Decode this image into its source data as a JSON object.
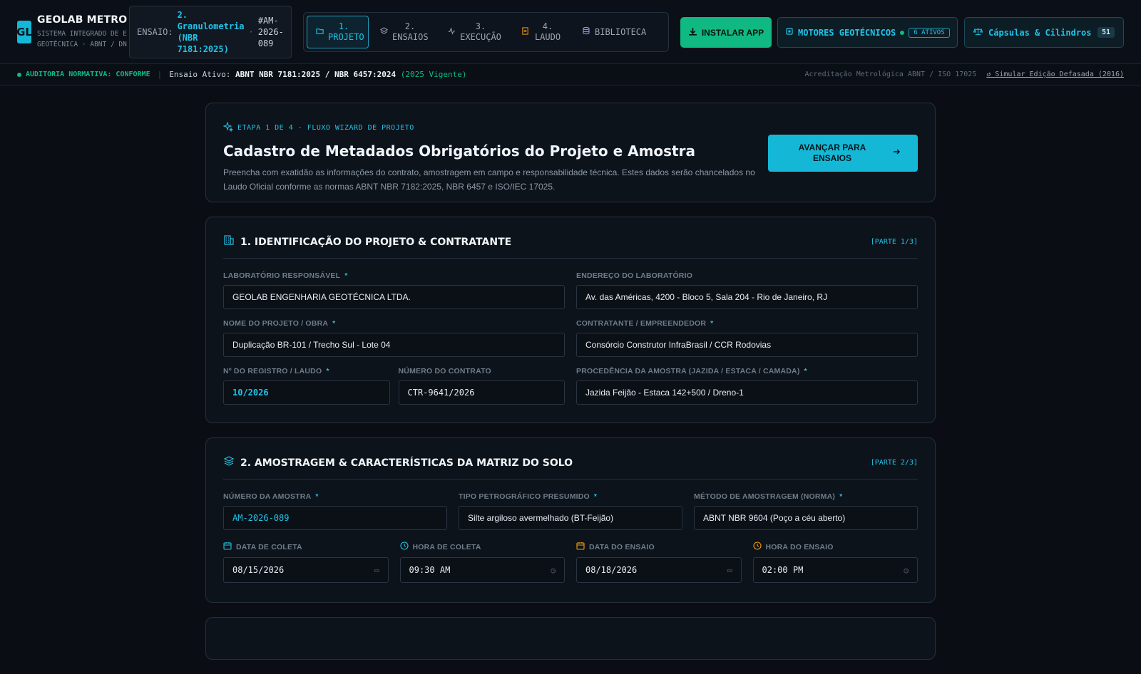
{
  "header": {
    "logo": "GL",
    "title": "GEOLAB METROL…",
    "subtitle_1": "SISTEMA INTEGRADO DE E",
    "subtitle_2": "GEOTÉCNICA · ABNT / DN",
    "ensaio_label": "ENSAIO:",
    "ensaio_name": "2. Granulometria (NBR 7181:2025)",
    "ensaio_id": "#AM-2026-089",
    "nav": [
      {
        "label": "1. PROJETO",
        "icon": "folder-icon",
        "active": true
      },
      {
        "label": "2. ENSAIOS",
        "icon": "layers-icon",
        "active": false
      },
      {
        "label": "3. EXECUÇÃO",
        "icon": "activity-icon",
        "active": false
      },
      {
        "label": "4. LAUDO",
        "icon": "document-icon",
        "active": false
      },
      {
        "label": "BIBLIOTECA",
        "icon": "database-icon",
        "active": false
      }
    ],
    "install_label": "INSTALAR APP",
    "motores_label": "MOTORES GEOTÉCNICOS",
    "motores_badge": "6 ATIVOS",
    "capsulas_label": "Cápsulas & Cilindros",
    "capsulas_count": "51"
  },
  "status": {
    "audit": "AUDITORIA NORMATIVA: CONFORME",
    "active_prefix": "Ensaio Ativo:",
    "active_norms": "ABNT NBR 7181:2025 / NBR 6457:2024",
    "active_vigente": "(2025 Vigente)",
    "accreditation": "Acreditação Metrológica ABNT / ISO 17025",
    "simulate": "Simular Edição Defasada (2016)"
  },
  "hero": {
    "step": "ETAPA 1 DE 4 · FLUXO WIZARD DE PROJETO",
    "title": "Cadastro de Metadados Obrigatórios do Projeto e Amostra",
    "description": "Preencha com exatidão as informações do contrato, amostragem em campo e responsabilidade técnica. Estes dados serão chancelados no Laudo Oficial conforme as normas ABNT NBR 7182:2025, NBR 6457 e ISO/IEC 17025.",
    "next_label": "AVANÇAR PARA ENSAIOS"
  },
  "section1": {
    "title": "1. IDENTIFICAÇÃO DO PROJETO & CONTRATANTE",
    "part": "[PARTE 1/3]",
    "lab_label": "LABORATÓRIO RESPONSÁVEL",
    "lab_value": "GEOLAB ENGENHARIA GEOTÉCNICA LTDA.",
    "addr_label": "ENDEREÇO DO LABORATÓRIO",
    "addr_value": "Av. das Américas, 4200 - Bloco 5, Sala 204 - Rio de Janeiro, RJ",
    "project_label": "NOME DO PROJETO / OBRA",
    "project_value": "Duplicação BR-101 / Trecho Sul - Lote 04",
    "client_label": "CONTRATANTE / EMPREENDEDOR",
    "client_value": "Consórcio Construtor InfraBrasil / CCR Rodovias",
    "reg_label": "Nº DO REGISTRO / LAUDO",
    "reg_value": "10/2026",
    "contract_label": "NÚMERO DO CONTRATO",
    "contract_value": "CTR-9641/2026",
    "origin_label": "PROCEDÊNCIA DA AMOSTRA (JAZIDA / ESTACA / CAMADA)",
    "origin_value": "Jazida Feijão - Estaca 142+500 / Dreno-1"
  },
  "section2": {
    "title": "2. AMOSTRAGEM & CARACTERÍSTICAS DA MATRIZ DO SOLO",
    "part": "[PARTE 2/3]",
    "sample_label": "NÚMERO DA AMOSTRA",
    "sample_value": "AM-2026-089",
    "petro_label": "TIPO PETROGRÁFICO PRESUMIDO",
    "petro_value": "Silte argiloso avermelhado (BT-Feijão)",
    "method_label": "MÉTODO DE AMOSTRAGEM (NORMA)",
    "method_value": "ABNT NBR 9604 (Poço a céu aberto)",
    "coleta_date_label": "DATA DE COLETA",
    "coleta_date_value": "08/15/2026",
    "coleta_time_label": "HORA DE COLETA",
    "coleta_time_value": "09:30 AM",
    "ensaio_date_label": "DATA DO ENSAIO",
    "ensaio_date_value": "08/18/2026",
    "ensaio_time_label": "HORA DO ENSAIO",
    "ensaio_time_value": "02:00 PM"
  },
  "colors": {
    "accent": "#14b8d6",
    "success": "#10b981",
    "warning": "#f59e0b",
    "background": "#0a0e14"
  }
}
